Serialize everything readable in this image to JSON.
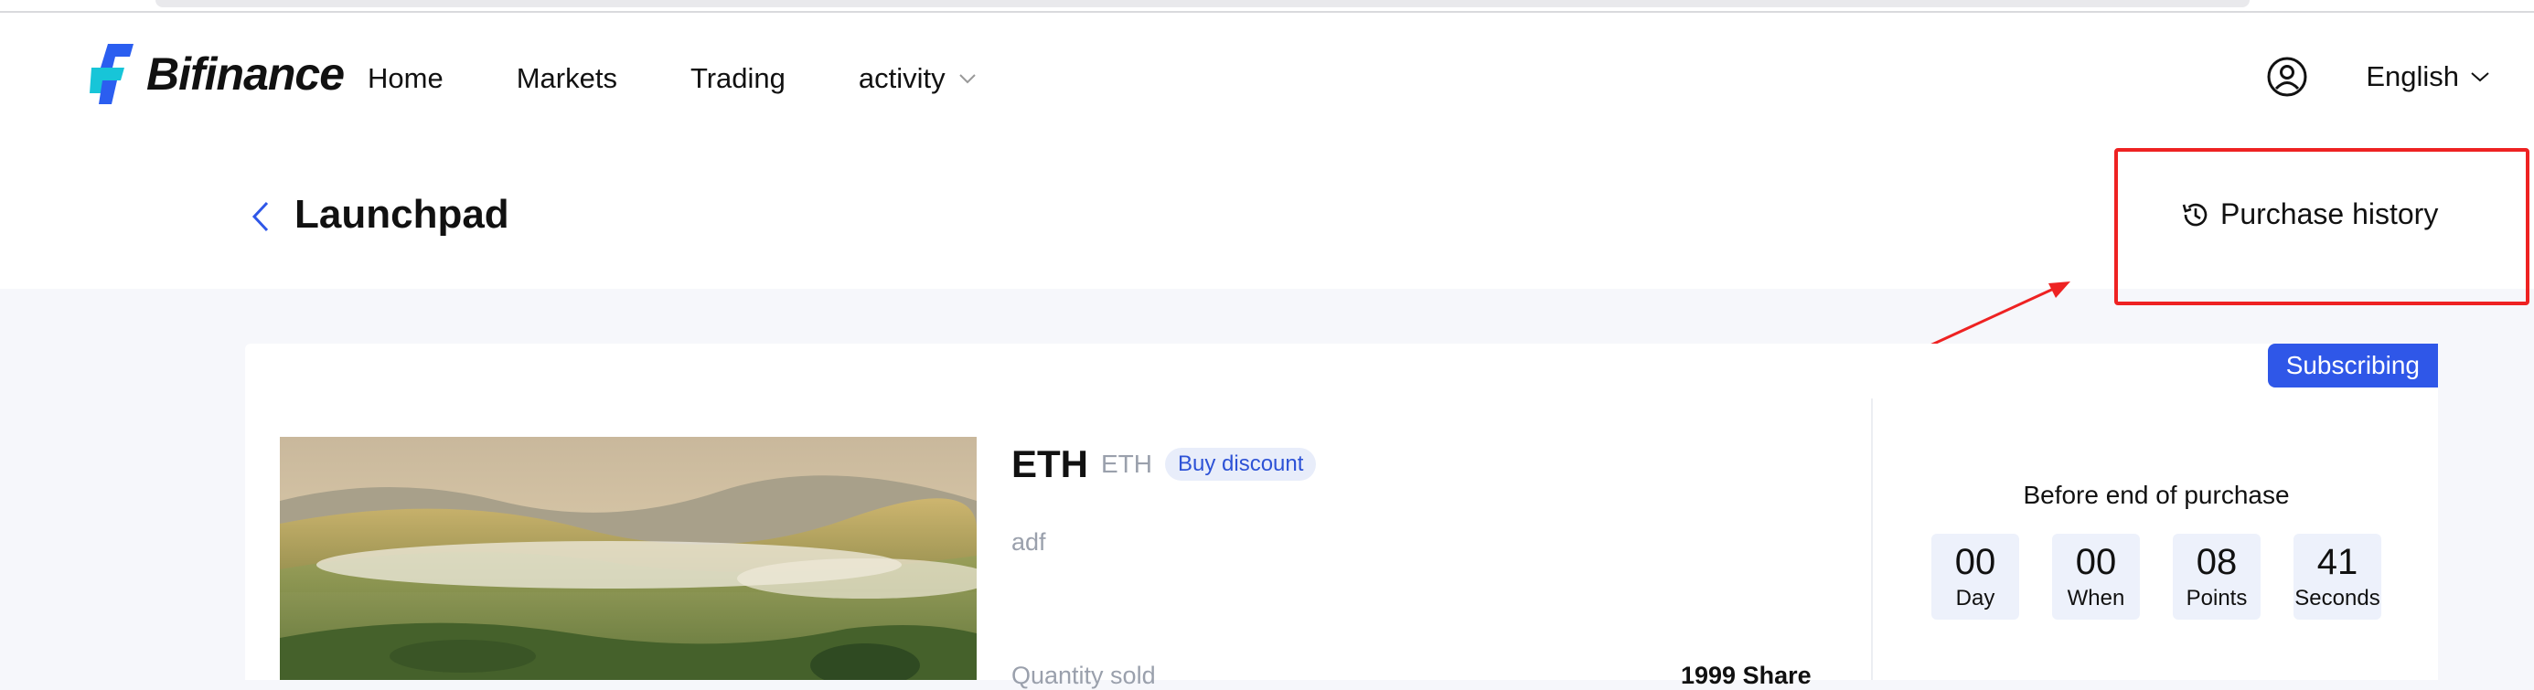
{
  "nav": {
    "brand": "Bifinance",
    "links": [
      {
        "label": "Home"
      },
      {
        "label": "Markets"
      },
      {
        "label": "Trading"
      },
      {
        "label": "activity"
      }
    ],
    "language": "English"
  },
  "page": {
    "title": "Launchpad",
    "purchase_history": "Purchase history"
  },
  "project": {
    "status": "Subscribing",
    "name": "ETH",
    "symbol": "ETH",
    "tag": "Buy discount",
    "description": "adf",
    "quantity_sold_label": "Quantity sold",
    "quantity_sold_value": "1999 Share"
  },
  "countdown": {
    "title": "Before end of purchase",
    "cells": [
      {
        "value": "00",
        "label": "Day"
      },
      {
        "value": "00",
        "label": "When"
      },
      {
        "value": "08",
        "label": "Points"
      },
      {
        "value": "41",
        "label": "Seconds"
      }
    ]
  },
  "colors": {
    "accent": "#2f57e8",
    "brand_cyan": "#17c5d8",
    "brand_blue": "#2b5ef0",
    "annotation_red": "#ee2222"
  }
}
